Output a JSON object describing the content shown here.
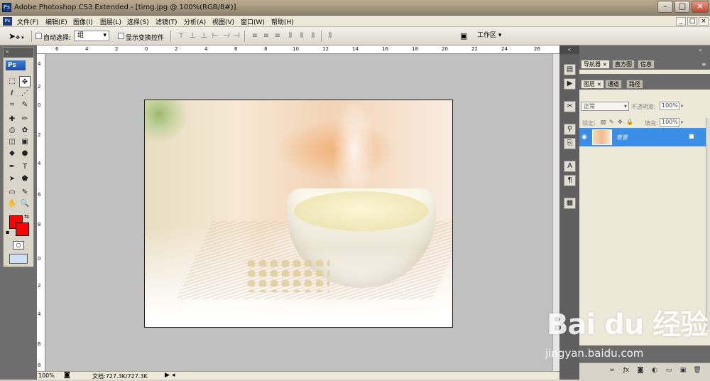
{
  "window": {
    "title": "Adobe Photoshop CS3 Extended - [timg.jpg @ 100%(RGB/8#)]",
    "app_icon": "Ps",
    "controls": [
      "–",
      "□",
      "×"
    ]
  },
  "menu": {
    "app_icon": "Ps",
    "items": [
      "文件(F)",
      "编辑(E)",
      "图像(I)",
      "图层(L)",
      "选择(S)",
      "滤镜(T)",
      "分析(A)",
      "视图(V)",
      "窗口(W)",
      "帮助(H)"
    ],
    "doc_controls": [
      "_",
      "□",
      "×"
    ]
  },
  "options": {
    "auto_select_label": "自动选择:",
    "auto_select_value": "组",
    "show_transform_label": "显示变换控件",
    "workspace_label": "工作区 ▾"
  },
  "toolbox": {
    "logo": "Ps",
    "tools": [
      [
        "⬚",
        "✥"
      ],
      [
        "ℓ",
        "⋰"
      ],
      [
        "⌗",
        "✎"
      ],
      [
        "✚",
        "✏"
      ],
      [
        "⎙",
        "✿"
      ],
      [
        "◫",
        "▣"
      ],
      [
        "◆",
        "●"
      ],
      [
        "✒",
        "T"
      ],
      [
        "➤",
        "⬟"
      ],
      [
        "▭",
        "✎"
      ],
      [
        "✋",
        "🔍"
      ]
    ],
    "fg_color": "#ff0000",
    "bg_color": "#ff0000"
  },
  "ruler": {
    "top_ticks": [
      "6",
      "4",
      "2",
      "0",
      "2",
      "4",
      "6",
      "8",
      "10",
      "12",
      "14",
      "16",
      "18",
      "20",
      "22",
      "24",
      "26"
    ],
    "left_ticks": [
      "4",
      "2",
      "0",
      "2",
      "4",
      "6",
      "8",
      "0",
      "2",
      "4",
      "6",
      "8"
    ]
  },
  "status": {
    "zoom": "100%",
    "doc_info": "文档:727.3K/727.3K"
  },
  "panels": {
    "top_tabs": [
      "导航器",
      "直方图",
      "信息"
    ],
    "layer_tabs": [
      "图层",
      "通道",
      "路径"
    ],
    "blend_mode": "正常",
    "opacity_label": "不透明度:",
    "opacity_value": "100%",
    "lock_label": "锁定:",
    "fill_label": "填充:",
    "fill_value": "100%",
    "layer_name": "背景"
  },
  "watermark": {
    "brand": "Bai du 经验",
    "url": "jingyan.baidu.com"
  }
}
